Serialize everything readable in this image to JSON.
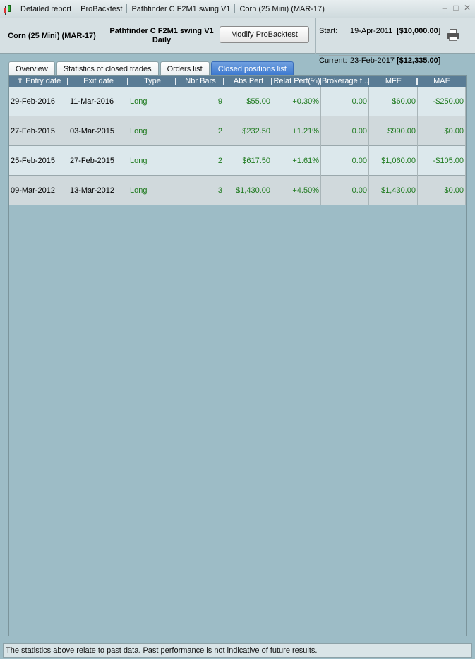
{
  "titlebar": {
    "segments": [
      "Detailed report",
      "ProBacktest",
      "Pathfinder C F2M1 swing V1",
      "Corn (25 Mini) (MAR-17)"
    ]
  },
  "header": {
    "instrument": "Corn (25 Mini) (MAR-17)",
    "strategy_name": "Pathfinder C F2M1 swing V1",
    "timeframe": "Daily",
    "modify_button": "Modify ProBacktest",
    "start_label": "Start:",
    "start_date": "19-Apr-2011",
    "start_amount": "[$10,000.00]",
    "current_label": "Current:",
    "current_date": "23-Feb-2017",
    "current_amount": "[$12,335.00]"
  },
  "tabs": [
    {
      "label": "Overview",
      "active": false
    },
    {
      "label": "Statistics of closed trades",
      "active": false
    },
    {
      "label": "Orders list",
      "active": false
    },
    {
      "label": "Closed positions list",
      "active": true
    }
  ],
  "table": {
    "sort_glyph": "⇧",
    "columns": [
      "Entry date",
      "Exit date",
      "Type",
      "Nbr Bars",
      "Abs Perf",
      "Relat Perf(%)",
      "Brokerage f...",
      "MFE",
      "MAE"
    ],
    "rows": [
      [
        "29-Feb-2016",
        "11-Mar-2016",
        "Long",
        "9",
        "$55.00",
        "+0.30%",
        "0.00",
        "$60.00",
        "-$250.00"
      ],
      [
        "27-Feb-2015",
        "03-Mar-2015",
        "Long",
        "2",
        "$232.50",
        "+1.21%",
        "0.00",
        "$990.00",
        "$0.00"
      ],
      [
        "25-Feb-2015",
        "27-Feb-2015",
        "Long",
        "2",
        "$617.50",
        "+1.61%",
        "0.00",
        "$1,060.00",
        "-$105.00"
      ],
      [
        "09-Mar-2012",
        "13-Mar-2012",
        "Long",
        "3",
        "$1,430.00",
        "+4.50%",
        "0.00",
        "$1,430.00",
        "$0.00"
      ]
    ]
  },
  "footer": {
    "disclaimer": "The statistics above relate to past data. Past performance is not indicative of future results."
  },
  "colors": {
    "background": "#9dbcc6",
    "header_row": "#5a7c95",
    "positive_text": "#1e7a1e",
    "active_tab": "#3b78cf"
  }
}
